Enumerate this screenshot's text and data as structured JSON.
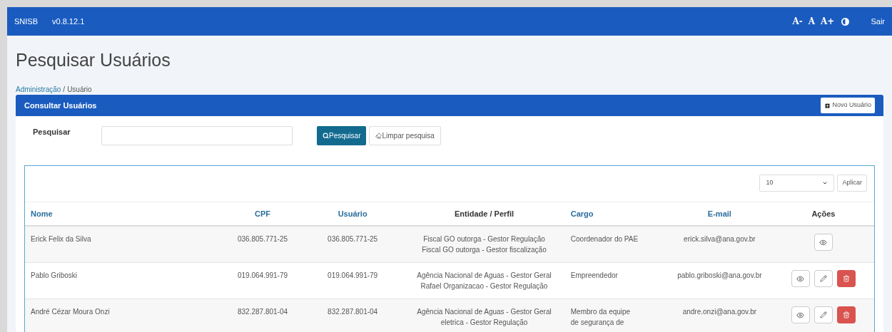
{
  "topbar": {
    "brand": "SNISB",
    "version": "v0.8.12.1",
    "font_controls": [
      "A-",
      "A",
      "A+"
    ],
    "logout": "Sair"
  },
  "page_title": "Pesquisar Usuários",
  "breadcrumb": {
    "separator": "/",
    "items": [
      {
        "label": "Administração",
        "link": true
      },
      {
        "label": "Usuário",
        "link": false
      }
    ]
  },
  "panel": {
    "title": "Consultar Usuários",
    "new_button": "Novo Usuário"
  },
  "search": {
    "label": "Pesquisar",
    "search_button": "Pesquisar",
    "clear_button": "Limpar pesquisa"
  },
  "page_size": {
    "value": "10",
    "apply_button": "Aplicar"
  },
  "table": {
    "columns": [
      {
        "label": "Nome",
        "sortable": true
      },
      {
        "label": "CPF",
        "sortable": true
      },
      {
        "label": "Usuário",
        "sortable": true
      },
      {
        "label": "Entidade / Perfil",
        "sortable": false
      },
      {
        "label": "Cargo",
        "sortable": true
      },
      {
        "label": "E-mail",
        "sortable": true
      },
      {
        "label": "Ações",
        "sortable": false
      }
    ],
    "rows": [
      {
        "cells": [
          "Erick Felix da Silva",
          "036.805.771-25",
          "036.805.771-25",
          [
            "Fiscal GO outorga - Gestor Regulação",
            "Fiscal GO outorga - Gestor fiscalização"
          ],
          [
            "Coordenador do PAE"
          ],
          "erick.silva@ana.gov.br"
        ],
        "actions": [
          {
            "kind": "view"
          }
        ]
      },
      {
        "cells": [
          "Pablo Griboski",
          "019.064.991-79",
          "019.064.991-79",
          [
            "Agência Nacional de Aguas - Gestor Geral",
            "Rafael Organizacao - Gestor Regulação"
          ],
          [
            "Empreendedor"
          ],
          "pablo.griboski@ana.gov.br"
        ],
        "actions": [
          {
            "kind": "view"
          },
          {
            "kind": "edit"
          },
          {
            "kind": "delete"
          }
        ]
      },
      {
        "cells": [
          "André Cézar Moura Onzi",
          "832.287.801-04",
          "832.287.801-04",
          [
            "Agência Nacional de Aguas - Gestor Geral",
            "eletrica - Gestor Regulação"
          ],
          [
            "Membro da equipe",
            "de segurança de"
          ],
          "andre.onzi@ana.gov.br"
        ],
        "actions": [
          {
            "kind": "view"
          },
          {
            "kind": "edit"
          },
          {
            "kind": "delete"
          }
        ]
      }
    ]
  }
}
